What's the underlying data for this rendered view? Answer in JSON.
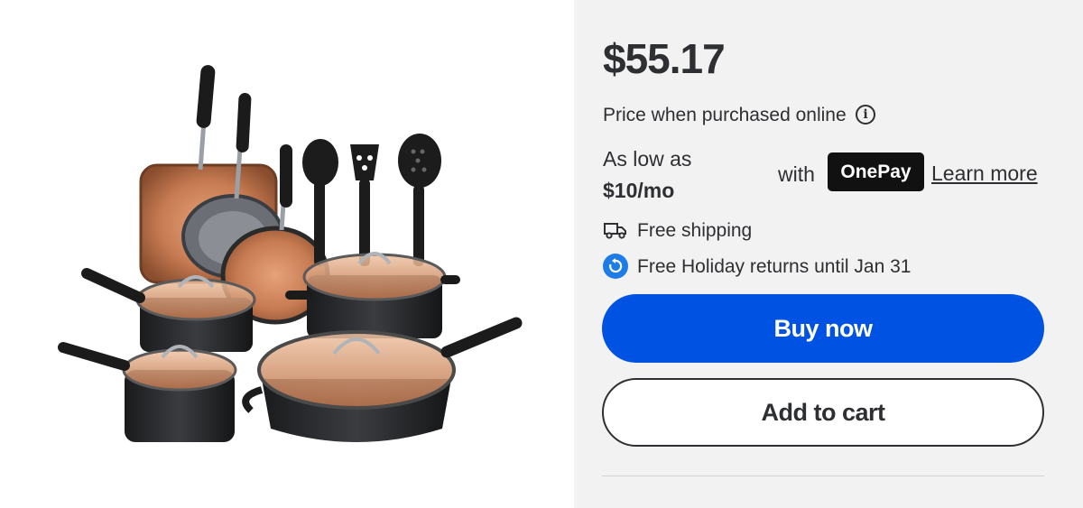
{
  "product": {
    "image_alt": "Copper cookware set with lids and utensils",
    "price": "$55.17",
    "price_note": "Price when purchased online",
    "installment": {
      "as_low_as": "As low as",
      "amount": "$10/mo",
      "with": "with",
      "provider": "OnePay",
      "learn_more": "Learn more"
    },
    "shipping": {
      "icon": "truck-icon",
      "text": "Free shipping"
    },
    "returns": {
      "icon": "return-icon",
      "text": "Free Holiday returns until Jan 31"
    },
    "buttons": {
      "buy_now": "Buy now",
      "add_to_cart": "Add to cart"
    }
  },
  "colors": {
    "primary_blue": "#0053e2",
    "return_icon_blue": "#1e7ce6",
    "panel_bg": "#f2f2f2",
    "text": "#2e2f32"
  }
}
